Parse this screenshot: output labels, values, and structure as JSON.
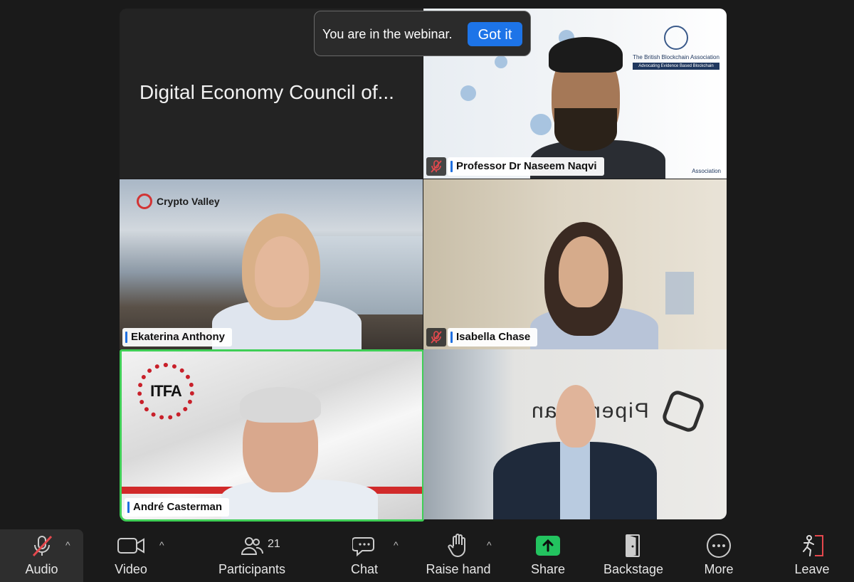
{
  "toast": {
    "message": "You are in the webinar.",
    "button": "Got it"
  },
  "title_tile": {
    "text": "Digital Economy Council of..."
  },
  "participants": [
    {
      "name": "Professor Dr Naseem Naqvi",
      "muted": true
    },
    {
      "name": "Ekaterina Anthony",
      "muted": false
    },
    {
      "name": "Isabella Chase",
      "muted": true
    },
    {
      "name": "André Casterman",
      "muted": false,
      "active_speaker": true
    }
  ],
  "backgrounds": {
    "bba_title": "The British Blockchain Association",
    "bba_tagline": "Advocating Evidence Based Blockchain",
    "bba_footer": "Association",
    "crypto_valley": "Crypto Valley",
    "itfa": "ITFA",
    "piper": "PiperA nan"
  },
  "toolbar": {
    "audio": "Audio",
    "video": "Video",
    "participants": "Participants",
    "participants_count": "21",
    "chat": "Chat",
    "raise_hand": "Raise hand",
    "share": "Share",
    "backstage": "Backstage",
    "more": "More",
    "leave": "Leave"
  },
  "colors": {
    "active_speaker_border": "#3fce56",
    "share_green": "#23c35f",
    "primary_blue": "#1d74e8",
    "mute_red": "#e5484d"
  }
}
